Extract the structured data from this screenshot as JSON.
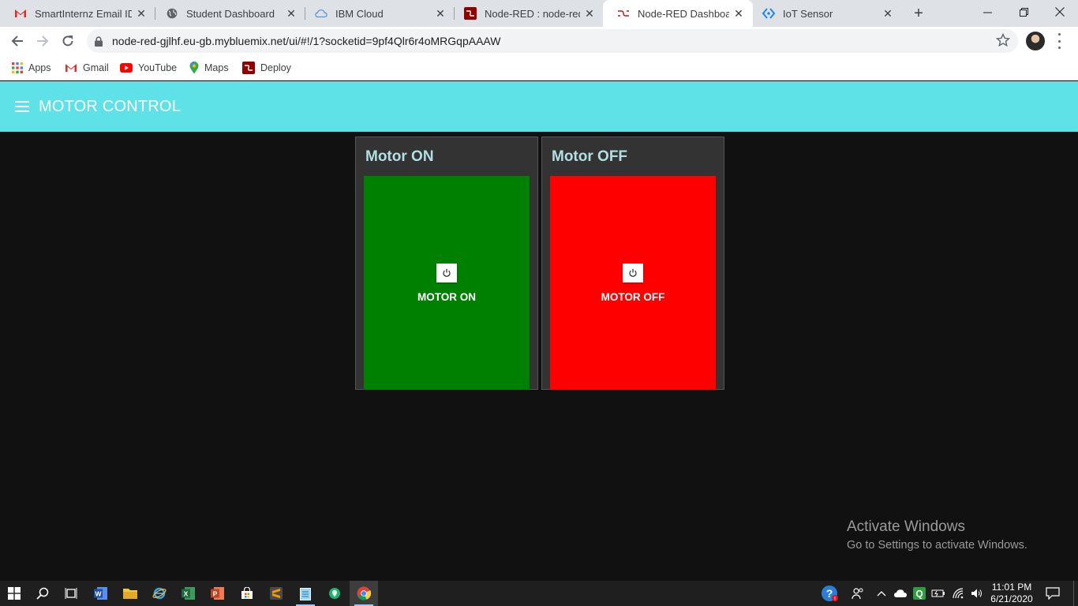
{
  "browser": {
    "tabs": [
      {
        "title": "SmartInternz Email ID for",
        "favicon": "gmail-icon",
        "active": false
      },
      {
        "title": "Student Dashboard",
        "favicon": "globe-icon",
        "active": false
      },
      {
        "title": "IBM Cloud",
        "favicon": "cloud-icon",
        "active": false
      },
      {
        "title": "Node-RED : node-red-g",
        "favicon": "node-red-icon",
        "active": false
      },
      {
        "title": "Node-RED Dashboard",
        "favicon": "node-red-dashboard-icon",
        "active": true
      },
      {
        "title": "IoT Sensor",
        "favicon": "iot-sensor-icon",
        "active": false
      }
    ],
    "url": "node-red-gjlhf.eu-gb.mybluemix.net/ui/#!/1?socketid=9pf4Qlr6r4oMRGqpAAAW",
    "bookmarks": [
      {
        "label": "Apps",
        "icon": "apps-grid-icon"
      },
      {
        "label": "Gmail",
        "icon": "gmail-icon"
      },
      {
        "label": "YouTube",
        "icon": "youtube-icon"
      },
      {
        "label": "Maps",
        "icon": "maps-icon"
      },
      {
        "label": "Deploy",
        "icon": "deploy-icon"
      }
    ]
  },
  "dashboard": {
    "title": "MOTOR CONTROL",
    "header_color": "#5fe1e8",
    "groups": [
      {
        "title": "Motor ON",
        "button_label": "MOTOR ON",
        "button_color": "#008000",
        "icon": "power-icon"
      },
      {
        "title": "Motor OFF",
        "button_label": "MOTOR OFF",
        "button_color": "#ff0000",
        "icon": "power-icon"
      }
    ]
  },
  "watermark": {
    "line1": "Activate Windows",
    "line2": "Go to Settings to activate Windows."
  },
  "taskbar": {
    "time": "11:01 PM",
    "date": "6/21/2020"
  }
}
